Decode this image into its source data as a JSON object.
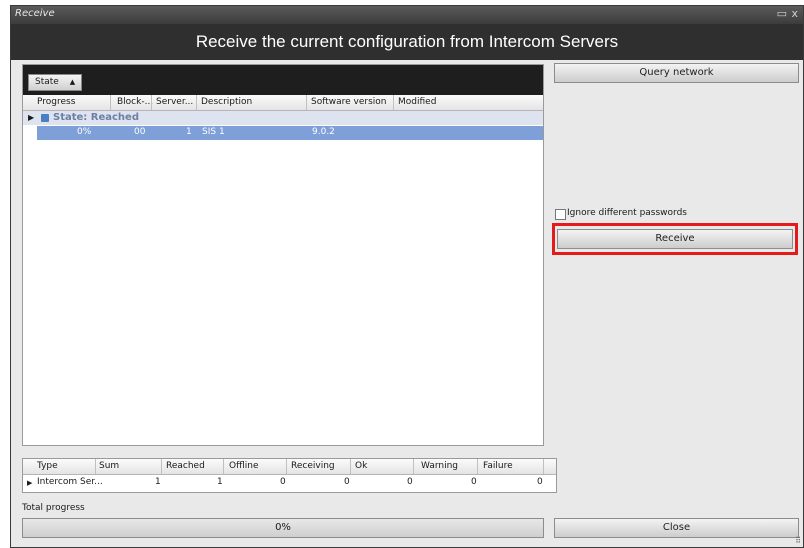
{
  "window": {
    "title": "Receive",
    "maximize_icon": "▭",
    "close_icon": "x"
  },
  "header": {
    "text": "Receive the current configuration from Intercom Servers"
  },
  "grid": {
    "group_chip": "State",
    "group_sort_icon": "▲",
    "columns": [
      "Progress",
      "Block-...",
      "Server...",
      "Description",
      "Software version",
      "Modified"
    ],
    "group_label": "State: Reached",
    "row": {
      "progress": "0%",
      "block": "00",
      "server": "1",
      "description": "SIS 1",
      "software_version": "9.0.2",
      "modified": ""
    },
    "selection_color": "#7f9fd8"
  },
  "side": {
    "query_button": "Query network",
    "ignore_checkbox_label": "Ignore different passwords",
    "ignore_checked": false,
    "receive_button": "Receive",
    "highlight_color": "#e31b1b"
  },
  "summary": {
    "columns": [
      "Type",
      "Sum",
      "Reached",
      "Offline",
      "Receiving",
      "Ok",
      "Warning",
      "Failure"
    ],
    "row": {
      "type": "Intercom Ser...",
      "sum": "1",
      "reached": "1",
      "offline": "0",
      "receiving": "0",
      "ok": "0",
      "warning": "0",
      "failure": "0"
    }
  },
  "footer": {
    "total_progress_label": "Total progress",
    "progress_text": "0%",
    "progress_value": 0,
    "close_button": "Close"
  }
}
